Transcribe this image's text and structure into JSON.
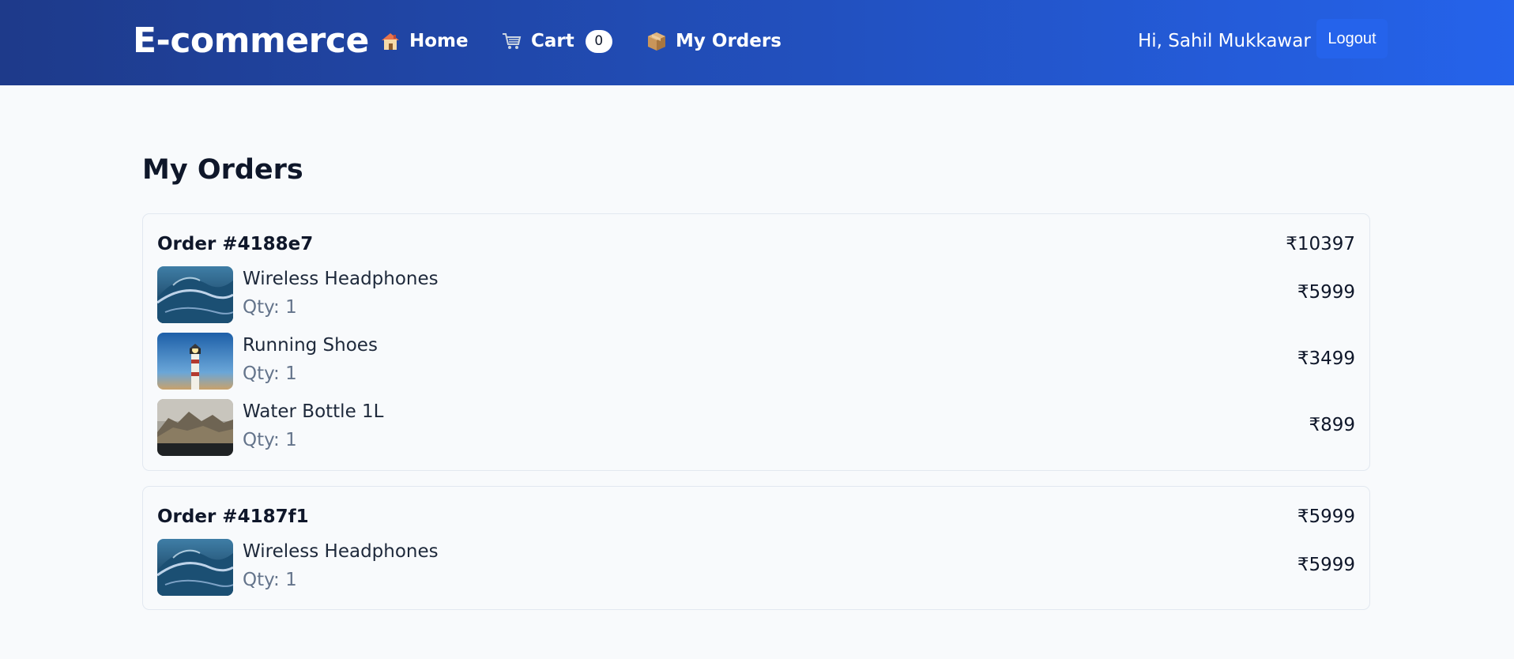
{
  "navbar": {
    "brand": "E-commerce",
    "links": [
      {
        "icon": "house-icon",
        "label": "Home"
      },
      {
        "icon": "cart-icon",
        "label": "Cart",
        "badge": "0"
      },
      {
        "icon": "package-icon",
        "label": "My Orders"
      }
    ],
    "greeting": "Hi, Sahil Mukkawar",
    "logout_label": "Logout"
  },
  "page": {
    "title": "My Orders"
  },
  "orders": [
    {
      "id": "Order #4188e7",
      "total": "₹10397",
      "items": [
        {
          "name": "Wireless Headphones",
          "qty": "Qty: 1",
          "price": "₹5999",
          "image": "ocean-wave-image"
        },
        {
          "name": "Running Shoes",
          "qty": "Qty: 1",
          "price": "₹3499",
          "image": "lighthouse-image"
        },
        {
          "name": "Water Bottle 1L",
          "qty": "Qty: 1",
          "price": "₹899",
          "image": "coastal-cliffs-image"
        }
      ]
    },
    {
      "id": "Order #4187f1",
      "total": "₹5999",
      "items": [
        {
          "name": "Wireless Headphones",
          "qty": "Qty: 1",
          "price": "₹5999",
          "image": "ocean-wave-image"
        }
      ]
    }
  ],
  "colors": {
    "navbar_start": "#1e3a8a",
    "navbar_end": "#2563eb",
    "page_background": "#f8fafc",
    "card_border": "#e2e8f0",
    "muted_text": "#64748b"
  }
}
